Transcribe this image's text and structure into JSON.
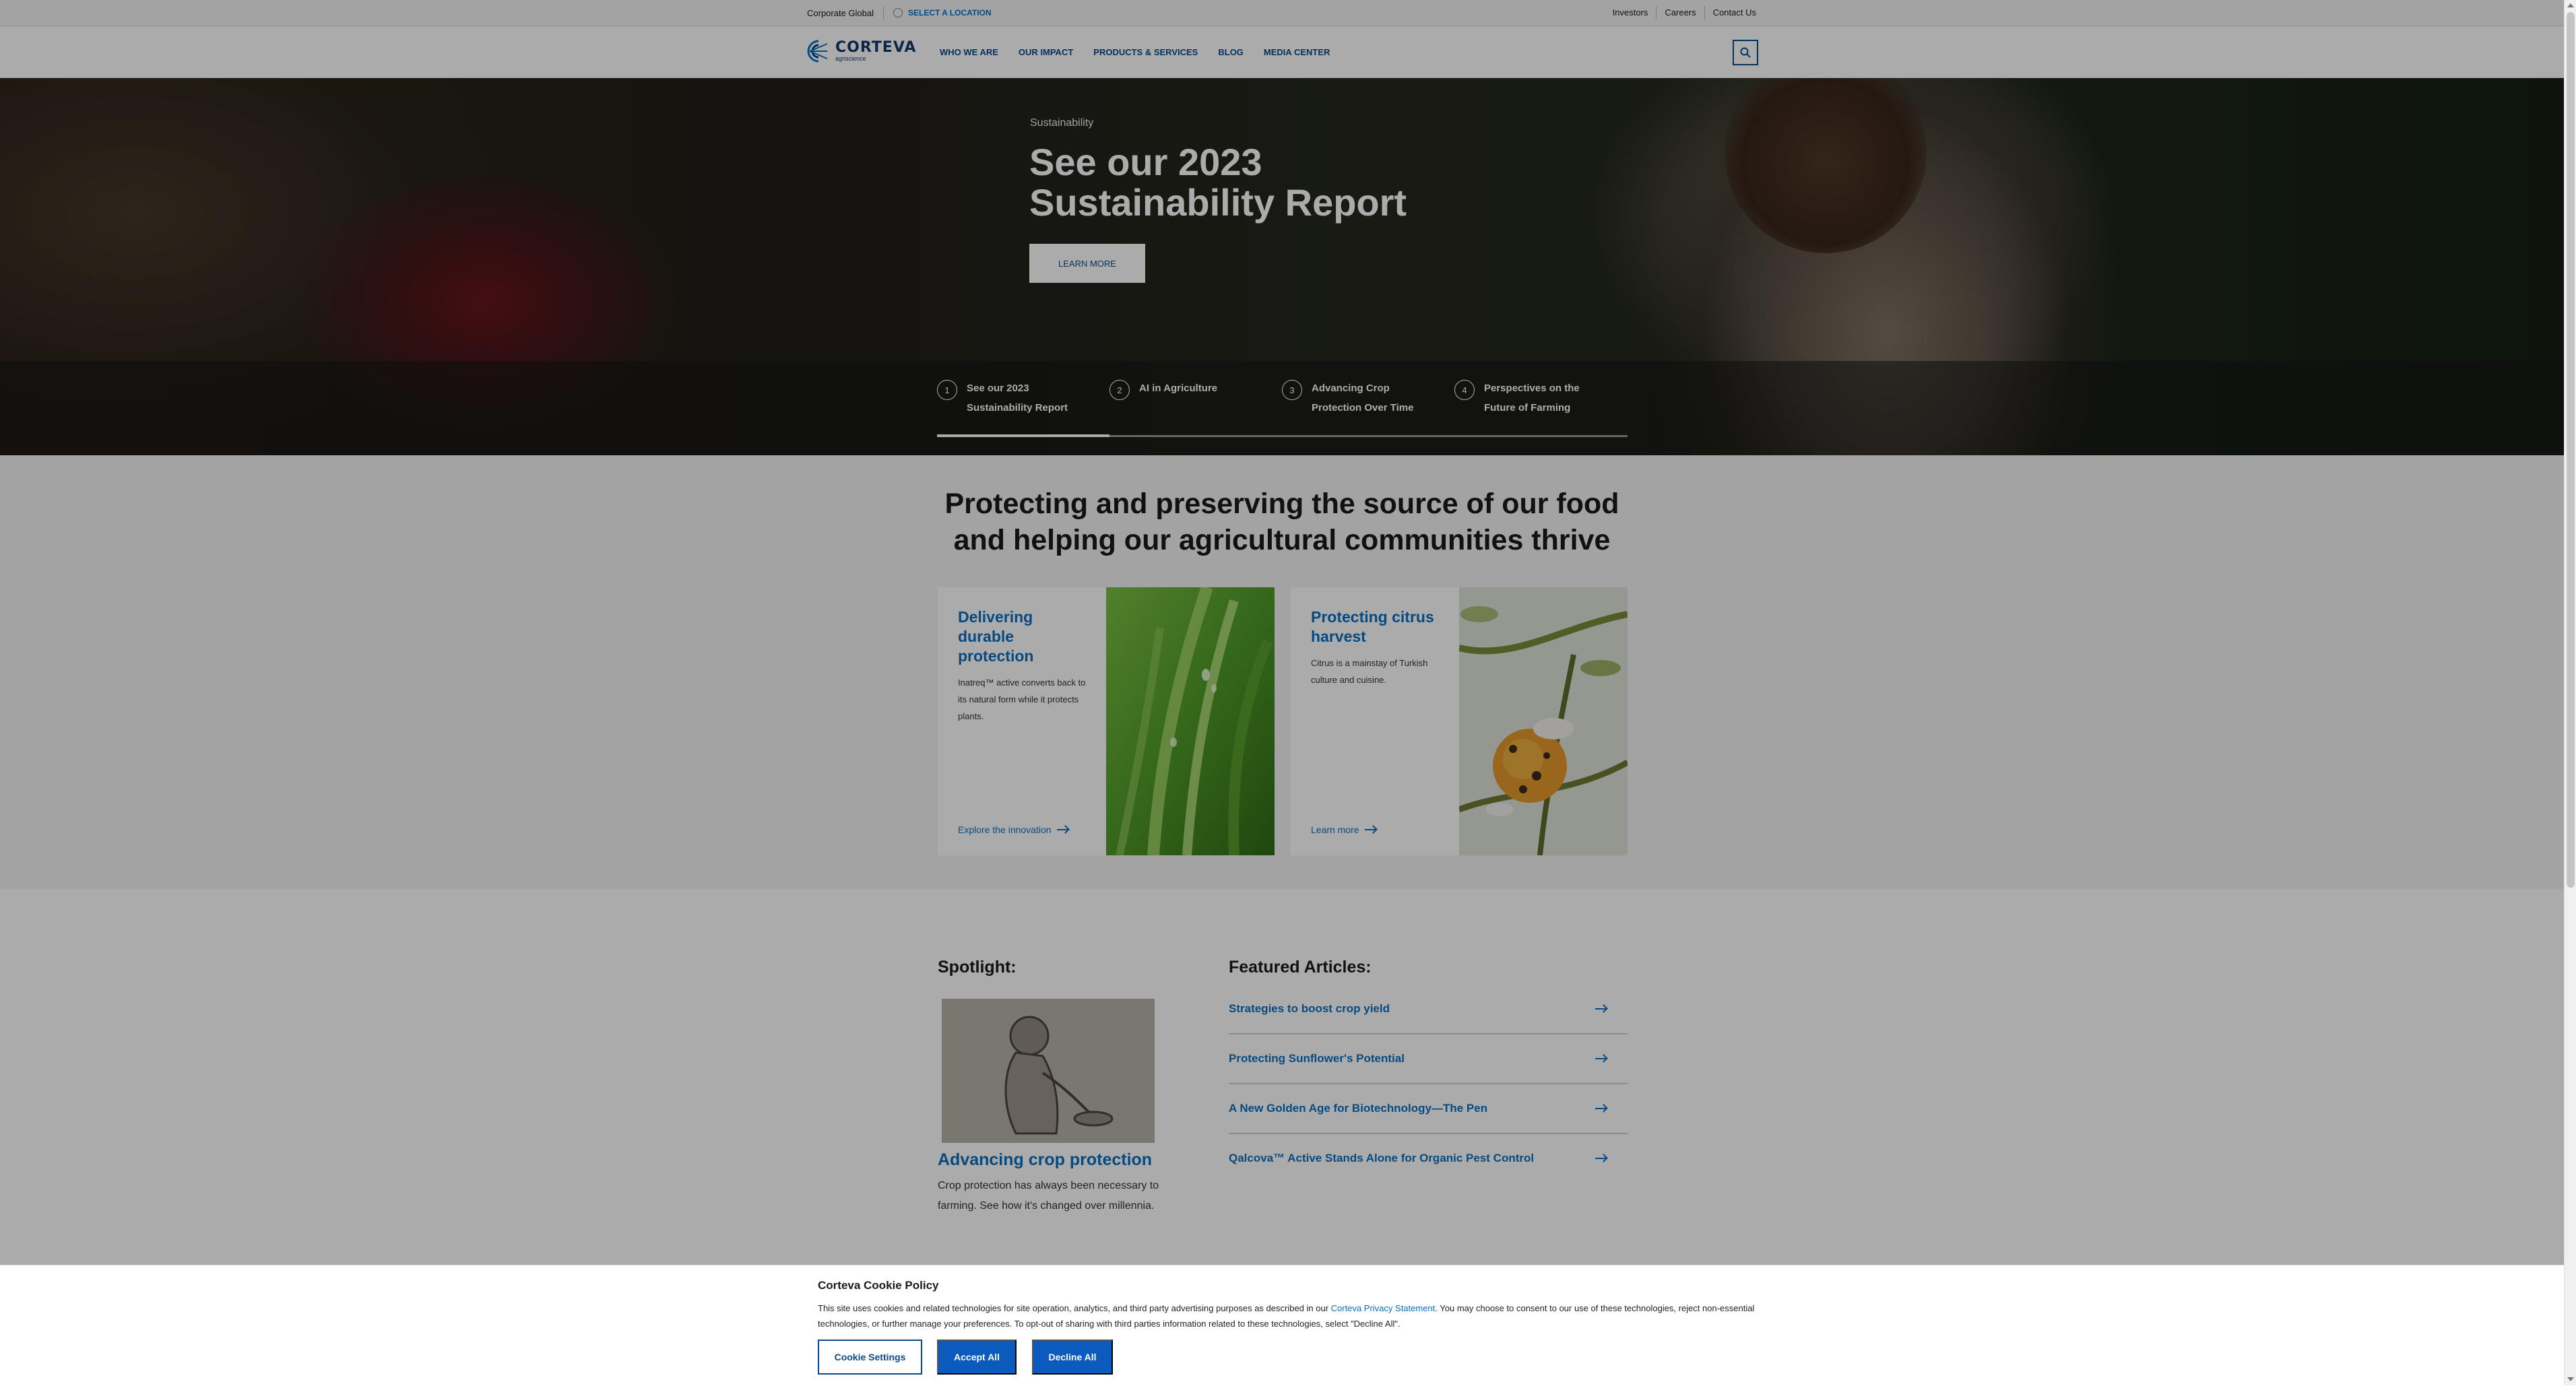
{
  "utility": {
    "corporate": "Corporate Global",
    "select_location": "SELECT A LOCATION",
    "links": [
      "Investors",
      "Careers",
      "Contact Us"
    ]
  },
  "brand": {
    "name": "CORTEVA",
    "sub": "agriscience",
    "color": "#123a6a",
    "accent": "#0a6fc2"
  },
  "nav": {
    "items": [
      "WHO WE ARE",
      "OUR IMPACT",
      "PRODUCTS & SERVICES",
      "BLOG",
      "MEDIA CENTER"
    ],
    "search_icon": "search-icon"
  },
  "hero": {
    "eyebrow": "Sustainability",
    "title": "See our 2023 Sustainability Report",
    "cta": "LEARN MORE",
    "tabs": [
      {
        "num": "1",
        "label": "See our 2023 Sustainability Report",
        "active": true
      },
      {
        "num": "2",
        "label": "AI in Agriculture",
        "active": false
      },
      {
        "num": "3",
        "label": "Advancing Crop Protection Over Time",
        "active": false
      },
      {
        "num": "4",
        "label": "Perspectives on the Future of Farming",
        "active": false
      }
    ]
  },
  "protect": {
    "title": "Protecting and preserving the source of our food and helping our agricultural communities thrive",
    "cards": [
      {
        "title": "Delivering durable protection",
        "body": "Inatreq™ active converts back to its natural form while it protects plants.",
        "link": "Explore the innovation"
      },
      {
        "title": "Protecting citrus harvest",
        "body": "Citrus is a mainstay of Turkish culture and cuisine.",
        "link": "Learn more"
      }
    ]
  },
  "spotlight": {
    "heading": "Spotlight:",
    "title": "Advancing crop protection",
    "body": "Crop protection has always been necessary to farming. See how it's changed over millennia."
  },
  "featured": {
    "heading": "Featured Articles:",
    "articles": [
      "Strategies to boost crop yield",
      "Protecting Sunflower's Potential",
      "A New Golden Age for Biotechnology—The Pen",
      "Qalcova™ Active Stands Alone for Organic Pest Control"
    ]
  },
  "cookie": {
    "title": "Corteva Cookie Policy",
    "text_before": "This site uses cookies and related technologies for site operation, analytics, and third party advertising purposes as described in our ",
    "privacy_link": "Corteva Privacy Statement",
    "text_after": ". You may choose to consent to our use of these technologies, reject non-essential technologies, or further manage your preferences. To opt-out of sharing with third parties information related to these technologies, select \"Decline All\".",
    "settings": "Cookie Settings",
    "accept": "Accept All",
    "decline": "Decline All"
  }
}
